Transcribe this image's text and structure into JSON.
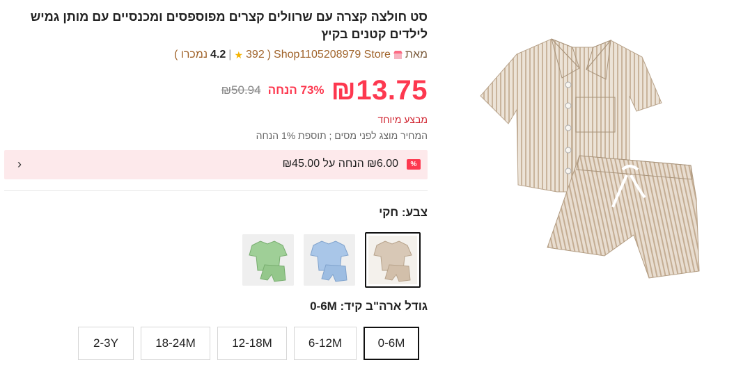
{
  "product": {
    "title": "סט חולצה קצרה עם שרוולים קצרים מפוספסים ומכנסיים עם מותן גמיש לילדים קטנים בקיץ",
    "image_icon": "striped-shirt-shorts-set-image"
  },
  "store": {
    "by_label": "מאת",
    "name": "Shop1105208979 Store",
    "rating": "4.2",
    "reviews": "392",
    "sold": "נמכרו )",
    "open_paren": "(",
    "separator": "|"
  },
  "pricing": {
    "price": "₪13.75",
    "discount": "73% הנחה",
    "old_price": "₪50.94",
    "special_deal": "מבצע מיוחד",
    "tax_note": "המחיר מוצג לפני מסים ; תוספת 1% הנחה"
  },
  "coupon": {
    "badge": "%",
    "text": "₪6.00 הנחה על ₪45.00",
    "chevron_icon": "chevron-left-icon"
  },
  "color": {
    "label": "צבע: חקי",
    "options": [
      {
        "name": "khaki",
        "selected": true,
        "hex": "#d8c8b6"
      },
      {
        "name": "blue",
        "selected": false,
        "hex": "#a9c6e8"
      },
      {
        "name": "green",
        "selected": false,
        "hex": "#9fcf97"
      }
    ]
  },
  "size": {
    "label": "גודל ארה\"ב קיד: 0-6M",
    "options": [
      "0-6M",
      "6-12M",
      "12-18M",
      "18-24M",
      "2-3Y"
    ],
    "selected": "0-6M"
  },
  "colors": {
    "accent": "#fd384f",
    "coupon_bg": "#fde9eb",
    "store_name": "#a0632a"
  }
}
